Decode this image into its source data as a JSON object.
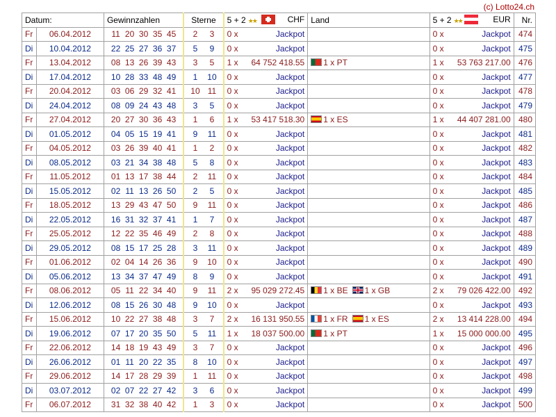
{
  "copyright": "(c) Lotto24.ch",
  "header": {
    "datum": "Datum:",
    "gewinnzahlen": "Gewinnzahlen",
    "sterne": "Sterne",
    "chf_prefix": "5 + 2",
    "chf_currency": "CHF",
    "land": "Land",
    "eur_prefix": "5 + 2",
    "eur_currency": "EUR",
    "nr": "Nr."
  },
  "icons": {
    "stars": "star-pair-icon",
    "chf_flag": "swiss-flag-icon",
    "eur_flag": "austrian-flag-icon"
  },
  "colors": {
    "friday_text": "#8b1a1a",
    "tuesday_text": "#0a2a8a",
    "stars_border": "#f0e68c",
    "copyright": "#b00000"
  },
  "rows": [
    {
      "day": "Fr",
      "date": "06.04.2012",
      "numbers": [
        "11",
        "20",
        "30",
        "35",
        "45"
      ],
      "stars": [
        "2",
        "3"
      ],
      "chf_count": "0 x",
      "chf_amount": "Jackpot",
      "winners": [],
      "eur_count": "0 x",
      "eur_amount": "Jackpot",
      "nr": "474"
    },
    {
      "day": "Di",
      "date": "10.04.2012",
      "numbers": [
        "22",
        "25",
        "27",
        "36",
        "37"
      ],
      "stars": [
        "5",
        "9"
      ],
      "chf_count": "0 x",
      "chf_amount": "Jackpot",
      "winners": [],
      "eur_count": "0 x",
      "eur_amount": "Jackpot",
      "nr": "475"
    },
    {
      "day": "Fr",
      "date": "13.04.2012",
      "numbers": [
        "08",
        "13",
        "26",
        "39",
        "43"
      ],
      "stars": [
        "3",
        "5"
      ],
      "chf_count": "1 x",
      "chf_amount": "64 752 418.55",
      "winners": [
        {
          "flag": "PT",
          "text": "1 x PT"
        }
      ],
      "eur_count": "1 x",
      "eur_amount": "53 763 217.00",
      "nr": "476"
    },
    {
      "day": "Di",
      "date": "17.04.2012",
      "numbers": [
        "10",
        "28",
        "33",
        "48",
        "49"
      ],
      "stars": [
        "1",
        "10"
      ],
      "chf_count": "0 x",
      "chf_amount": "Jackpot",
      "winners": [],
      "eur_count": "0 x",
      "eur_amount": "Jackpot",
      "nr": "477"
    },
    {
      "day": "Fr",
      "date": "20.04.2012",
      "numbers": [
        "03",
        "06",
        "29",
        "32",
        "41"
      ],
      "stars": [
        "10",
        "11"
      ],
      "chf_count": "0 x",
      "chf_amount": "Jackpot",
      "winners": [],
      "eur_count": "0 x",
      "eur_amount": "Jackpot",
      "nr": "478"
    },
    {
      "day": "Di",
      "date": "24.04.2012",
      "numbers": [
        "08",
        "09",
        "24",
        "43",
        "48"
      ],
      "stars": [
        "3",
        "5"
      ],
      "chf_count": "0 x",
      "chf_amount": "Jackpot",
      "winners": [],
      "eur_count": "0 x",
      "eur_amount": "Jackpot",
      "nr": "479"
    },
    {
      "day": "Fr",
      "date": "27.04.2012",
      "numbers": [
        "20",
        "27",
        "30",
        "36",
        "43"
      ],
      "stars": [
        "1",
        "6"
      ],
      "chf_count": "1 x",
      "chf_amount": "53 417 518.30",
      "winners": [
        {
          "flag": "ES",
          "text": "1 x ES"
        }
      ],
      "eur_count": "1 x",
      "eur_amount": "44 407 281.00",
      "nr": "480"
    },
    {
      "day": "Di",
      "date": "01.05.2012",
      "numbers": [
        "04",
        "05",
        "15",
        "19",
        "41"
      ],
      "stars": [
        "9",
        "11"
      ],
      "chf_count": "0 x",
      "chf_amount": "Jackpot",
      "winners": [],
      "eur_count": "0 x",
      "eur_amount": "Jackpot",
      "nr": "481"
    },
    {
      "day": "Fr",
      "date": "04.05.2012",
      "numbers": [
        "03",
        "26",
        "39",
        "40",
        "41"
      ],
      "stars": [
        "1",
        "2"
      ],
      "chf_count": "0 x",
      "chf_amount": "Jackpot",
      "winners": [],
      "eur_count": "0 x",
      "eur_amount": "Jackpot",
      "nr": "482"
    },
    {
      "day": "Di",
      "date": "08.05.2012",
      "numbers": [
        "03",
        "21",
        "34",
        "38",
        "48"
      ],
      "stars": [
        "5",
        "8"
      ],
      "chf_count": "0 x",
      "chf_amount": "Jackpot",
      "winners": [],
      "eur_count": "0 x",
      "eur_amount": "Jackpot",
      "nr": "483"
    },
    {
      "day": "Fr",
      "date": "11.05.2012",
      "numbers": [
        "01",
        "13",
        "17",
        "38",
        "44"
      ],
      "stars": [
        "2",
        "11"
      ],
      "chf_count": "0 x",
      "chf_amount": "Jackpot",
      "winners": [],
      "eur_count": "0 x",
      "eur_amount": "Jackpot",
      "nr": "484"
    },
    {
      "day": "Di",
      "date": "15.05.2012",
      "numbers": [
        "02",
        "11",
        "13",
        "26",
        "50"
      ],
      "stars": [
        "2",
        "5"
      ],
      "chf_count": "0 x",
      "chf_amount": "Jackpot",
      "winners": [],
      "eur_count": "0 x",
      "eur_amount": "Jackpot",
      "nr": "485"
    },
    {
      "day": "Fr",
      "date": "18.05.2012",
      "numbers": [
        "13",
        "29",
        "43",
        "47",
        "50"
      ],
      "stars": [
        "9",
        "11"
      ],
      "chf_count": "0 x",
      "chf_amount": "Jackpot",
      "winners": [],
      "eur_count": "0 x",
      "eur_amount": "Jackpot",
      "nr": "486"
    },
    {
      "day": "Di",
      "date": "22.05.2012",
      "numbers": [
        "16",
        "31",
        "32",
        "37",
        "41"
      ],
      "stars": [
        "1",
        "7"
      ],
      "chf_count": "0 x",
      "chf_amount": "Jackpot",
      "winners": [],
      "eur_count": "0 x",
      "eur_amount": "Jackpot",
      "nr": "487"
    },
    {
      "day": "Fr",
      "date": "25.05.2012",
      "numbers": [
        "12",
        "22",
        "35",
        "46",
        "49"
      ],
      "stars": [
        "2",
        "8"
      ],
      "chf_count": "0 x",
      "chf_amount": "Jackpot",
      "winners": [],
      "eur_count": "0 x",
      "eur_amount": "Jackpot",
      "nr": "488"
    },
    {
      "day": "Di",
      "date": "29.05.2012",
      "numbers": [
        "08",
        "15",
        "17",
        "25",
        "28"
      ],
      "stars": [
        "3",
        "11"
      ],
      "chf_count": "0 x",
      "chf_amount": "Jackpot",
      "winners": [],
      "eur_count": "0 x",
      "eur_amount": "Jackpot",
      "nr": "489"
    },
    {
      "day": "Fr",
      "date": "01.06.2012",
      "numbers": [
        "02",
        "04",
        "14",
        "26",
        "36"
      ],
      "stars": [
        "9",
        "10"
      ],
      "chf_count": "0 x",
      "chf_amount": "Jackpot",
      "winners": [],
      "eur_count": "0 x",
      "eur_amount": "Jackpot",
      "nr": "490"
    },
    {
      "day": "Di",
      "date": "05.06.2012",
      "numbers": [
        "13",
        "34",
        "37",
        "47",
        "49"
      ],
      "stars": [
        "8",
        "9"
      ],
      "chf_count": "0 x",
      "chf_amount": "Jackpot",
      "winners": [],
      "eur_count": "0 x",
      "eur_amount": "Jackpot",
      "nr": "491"
    },
    {
      "day": "Fr",
      "date": "08.06.2012",
      "numbers": [
        "05",
        "11",
        "22",
        "34",
        "40"
      ],
      "stars": [
        "9",
        "11"
      ],
      "chf_count": "2 x",
      "chf_amount": "95 029 272.45",
      "winners": [
        {
          "flag": "BE",
          "text": "1 x BE"
        },
        {
          "flag": "GB",
          "text": "1 x GB"
        }
      ],
      "eur_count": "2 x",
      "eur_amount": "79 026 422.00",
      "nr": "492"
    },
    {
      "day": "Di",
      "date": "12.06.2012",
      "numbers": [
        "08",
        "15",
        "26",
        "30",
        "48"
      ],
      "stars": [
        "9",
        "10"
      ],
      "chf_count": "0 x",
      "chf_amount": "Jackpot",
      "winners": [],
      "eur_count": "0 x",
      "eur_amount": "Jackpot",
      "nr": "493"
    },
    {
      "day": "Fr",
      "date": "15.06.2012",
      "numbers": [
        "10",
        "22",
        "27",
        "38",
        "48"
      ],
      "stars": [
        "3",
        "7"
      ],
      "chf_count": "2 x",
      "chf_amount": "16 131 950.55",
      "winners": [
        {
          "flag": "FR",
          "text": "1 x FR"
        },
        {
          "flag": "ES",
          "text": "1 x ES"
        }
      ],
      "eur_count": "2 x",
      "eur_amount": "13 414 228.00",
      "nr": "494"
    },
    {
      "day": "Di",
      "date": "19.06.2012",
      "numbers": [
        "07",
        "17",
        "20",
        "35",
        "50"
      ],
      "stars": [
        "5",
        "11"
      ],
      "chf_count": "1 x",
      "chf_amount": "18 037 500.00",
      "winners": [
        {
          "flag": "PT",
          "text": "1 x PT"
        }
      ],
      "eur_count": "1 x",
      "eur_amount": "15 000 000.00",
      "nr": "495"
    },
    {
      "day": "Fr",
      "date": "22.06.2012",
      "numbers": [
        "14",
        "18",
        "19",
        "43",
        "49"
      ],
      "stars": [
        "3",
        "7"
      ],
      "chf_count": "0 x",
      "chf_amount": "Jackpot",
      "winners": [],
      "eur_count": "0 x",
      "eur_amount": "Jackpot",
      "nr": "496"
    },
    {
      "day": "Di",
      "date": "26.06.2012",
      "numbers": [
        "01",
        "11",
        "20",
        "22",
        "35"
      ],
      "stars": [
        "8",
        "10"
      ],
      "chf_count": "0 x",
      "chf_amount": "Jackpot",
      "winners": [],
      "eur_count": "0 x",
      "eur_amount": "Jackpot",
      "nr": "497"
    },
    {
      "day": "Fr",
      "date": "29.06.2012",
      "numbers": [
        "14",
        "17",
        "28",
        "29",
        "39"
      ],
      "stars": [
        "1",
        "11"
      ],
      "chf_count": "0 x",
      "chf_amount": "Jackpot",
      "winners": [],
      "eur_count": "0 x",
      "eur_amount": "Jackpot",
      "nr": "498"
    },
    {
      "day": "Di",
      "date": "03.07.2012",
      "numbers": [
        "02",
        "07",
        "22",
        "27",
        "42"
      ],
      "stars": [
        "3",
        "6"
      ],
      "chf_count": "0 x",
      "chf_amount": "Jackpot",
      "winners": [],
      "eur_count": "0 x",
      "eur_amount": "Jackpot",
      "nr": "499"
    },
    {
      "day": "Fr",
      "date": "06.07.2012",
      "numbers": [
        "31",
        "32",
        "38",
        "40",
        "42"
      ],
      "stars": [
        "1",
        "3"
      ],
      "chf_count": "0 x",
      "chf_amount": "Jackpot",
      "winners": [],
      "eur_count": "0 x",
      "eur_amount": "Jackpot",
      "nr": "500"
    }
  ]
}
